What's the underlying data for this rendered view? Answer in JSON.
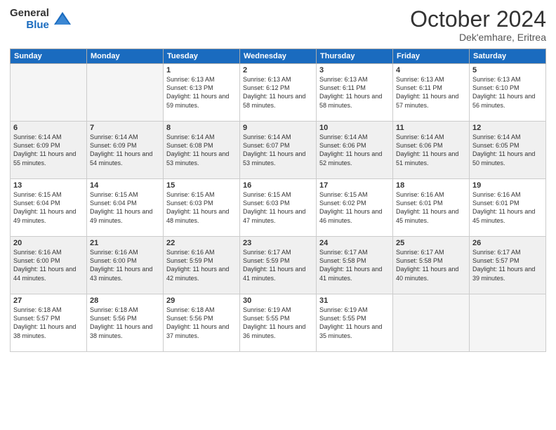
{
  "logo": {
    "text_general": "General",
    "text_blue": "Blue"
  },
  "header": {
    "month": "October 2024",
    "location": "Dek'emhare, Eritrea"
  },
  "weekdays": [
    "Sunday",
    "Monday",
    "Tuesday",
    "Wednesday",
    "Thursday",
    "Friday",
    "Saturday"
  ],
  "weeks": [
    [
      {
        "day": "",
        "sunrise": "",
        "sunset": "",
        "daylight": "",
        "empty": true
      },
      {
        "day": "",
        "sunrise": "",
        "sunset": "",
        "daylight": "",
        "empty": true
      },
      {
        "day": "1",
        "sunrise": "Sunrise: 6:13 AM",
        "sunset": "Sunset: 6:13 PM",
        "daylight": "Daylight: 11 hours and 59 minutes."
      },
      {
        "day": "2",
        "sunrise": "Sunrise: 6:13 AM",
        "sunset": "Sunset: 6:12 PM",
        "daylight": "Daylight: 11 hours and 58 minutes."
      },
      {
        "day": "3",
        "sunrise": "Sunrise: 6:13 AM",
        "sunset": "Sunset: 6:11 PM",
        "daylight": "Daylight: 11 hours and 58 minutes."
      },
      {
        "day": "4",
        "sunrise": "Sunrise: 6:13 AM",
        "sunset": "Sunset: 6:11 PM",
        "daylight": "Daylight: 11 hours and 57 minutes."
      },
      {
        "day": "5",
        "sunrise": "Sunrise: 6:13 AM",
        "sunset": "Sunset: 6:10 PM",
        "daylight": "Daylight: 11 hours and 56 minutes."
      }
    ],
    [
      {
        "day": "6",
        "sunrise": "Sunrise: 6:14 AM",
        "sunset": "Sunset: 6:09 PM",
        "daylight": "Daylight: 11 hours and 55 minutes."
      },
      {
        "day": "7",
        "sunrise": "Sunrise: 6:14 AM",
        "sunset": "Sunset: 6:09 PM",
        "daylight": "Daylight: 11 hours and 54 minutes."
      },
      {
        "day": "8",
        "sunrise": "Sunrise: 6:14 AM",
        "sunset": "Sunset: 6:08 PM",
        "daylight": "Daylight: 11 hours and 53 minutes."
      },
      {
        "day": "9",
        "sunrise": "Sunrise: 6:14 AM",
        "sunset": "Sunset: 6:07 PM",
        "daylight": "Daylight: 11 hours and 53 minutes."
      },
      {
        "day": "10",
        "sunrise": "Sunrise: 6:14 AM",
        "sunset": "Sunset: 6:06 PM",
        "daylight": "Daylight: 11 hours and 52 minutes."
      },
      {
        "day": "11",
        "sunrise": "Sunrise: 6:14 AM",
        "sunset": "Sunset: 6:06 PM",
        "daylight": "Daylight: 11 hours and 51 minutes."
      },
      {
        "day": "12",
        "sunrise": "Sunrise: 6:14 AM",
        "sunset": "Sunset: 6:05 PM",
        "daylight": "Daylight: 11 hours and 50 minutes."
      }
    ],
    [
      {
        "day": "13",
        "sunrise": "Sunrise: 6:15 AM",
        "sunset": "Sunset: 6:04 PM",
        "daylight": "Daylight: 11 hours and 49 minutes."
      },
      {
        "day": "14",
        "sunrise": "Sunrise: 6:15 AM",
        "sunset": "Sunset: 6:04 PM",
        "daylight": "Daylight: 11 hours and 49 minutes."
      },
      {
        "day": "15",
        "sunrise": "Sunrise: 6:15 AM",
        "sunset": "Sunset: 6:03 PM",
        "daylight": "Daylight: 11 hours and 48 minutes."
      },
      {
        "day": "16",
        "sunrise": "Sunrise: 6:15 AM",
        "sunset": "Sunset: 6:03 PM",
        "daylight": "Daylight: 11 hours and 47 minutes."
      },
      {
        "day": "17",
        "sunrise": "Sunrise: 6:15 AM",
        "sunset": "Sunset: 6:02 PM",
        "daylight": "Daylight: 11 hours and 46 minutes."
      },
      {
        "day": "18",
        "sunrise": "Sunrise: 6:16 AM",
        "sunset": "Sunset: 6:01 PM",
        "daylight": "Daylight: 11 hours and 45 minutes."
      },
      {
        "day": "19",
        "sunrise": "Sunrise: 6:16 AM",
        "sunset": "Sunset: 6:01 PM",
        "daylight": "Daylight: 11 hours and 45 minutes."
      }
    ],
    [
      {
        "day": "20",
        "sunrise": "Sunrise: 6:16 AM",
        "sunset": "Sunset: 6:00 PM",
        "daylight": "Daylight: 11 hours and 44 minutes."
      },
      {
        "day": "21",
        "sunrise": "Sunrise: 6:16 AM",
        "sunset": "Sunset: 6:00 PM",
        "daylight": "Daylight: 11 hours and 43 minutes."
      },
      {
        "day": "22",
        "sunrise": "Sunrise: 6:16 AM",
        "sunset": "Sunset: 5:59 PM",
        "daylight": "Daylight: 11 hours and 42 minutes."
      },
      {
        "day": "23",
        "sunrise": "Sunrise: 6:17 AM",
        "sunset": "Sunset: 5:59 PM",
        "daylight": "Daylight: 11 hours and 41 minutes."
      },
      {
        "day": "24",
        "sunrise": "Sunrise: 6:17 AM",
        "sunset": "Sunset: 5:58 PM",
        "daylight": "Daylight: 11 hours and 41 minutes."
      },
      {
        "day": "25",
        "sunrise": "Sunrise: 6:17 AM",
        "sunset": "Sunset: 5:58 PM",
        "daylight": "Daylight: 11 hours and 40 minutes."
      },
      {
        "day": "26",
        "sunrise": "Sunrise: 6:17 AM",
        "sunset": "Sunset: 5:57 PM",
        "daylight": "Daylight: 11 hours and 39 minutes."
      }
    ],
    [
      {
        "day": "27",
        "sunrise": "Sunrise: 6:18 AM",
        "sunset": "Sunset: 5:57 PM",
        "daylight": "Daylight: 11 hours and 38 minutes."
      },
      {
        "day": "28",
        "sunrise": "Sunrise: 6:18 AM",
        "sunset": "Sunset: 5:56 PM",
        "daylight": "Daylight: 11 hours and 38 minutes."
      },
      {
        "day": "29",
        "sunrise": "Sunrise: 6:18 AM",
        "sunset": "Sunset: 5:56 PM",
        "daylight": "Daylight: 11 hours and 37 minutes."
      },
      {
        "day": "30",
        "sunrise": "Sunrise: 6:19 AM",
        "sunset": "Sunset: 5:55 PM",
        "daylight": "Daylight: 11 hours and 36 minutes."
      },
      {
        "day": "31",
        "sunrise": "Sunrise: 6:19 AM",
        "sunset": "Sunset: 5:55 PM",
        "daylight": "Daylight: 11 hours and 35 minutes."
      },
      {
        "day": "",
        "sunrise": "",
        "sunset": "",
        "daylight": "",
        "empty": true
      },
      {
        "day": "",
        "sunrise": "",
        "sunset": "",
        "daylight": "",
        "empty": true
      }
    ]
  ]
}
